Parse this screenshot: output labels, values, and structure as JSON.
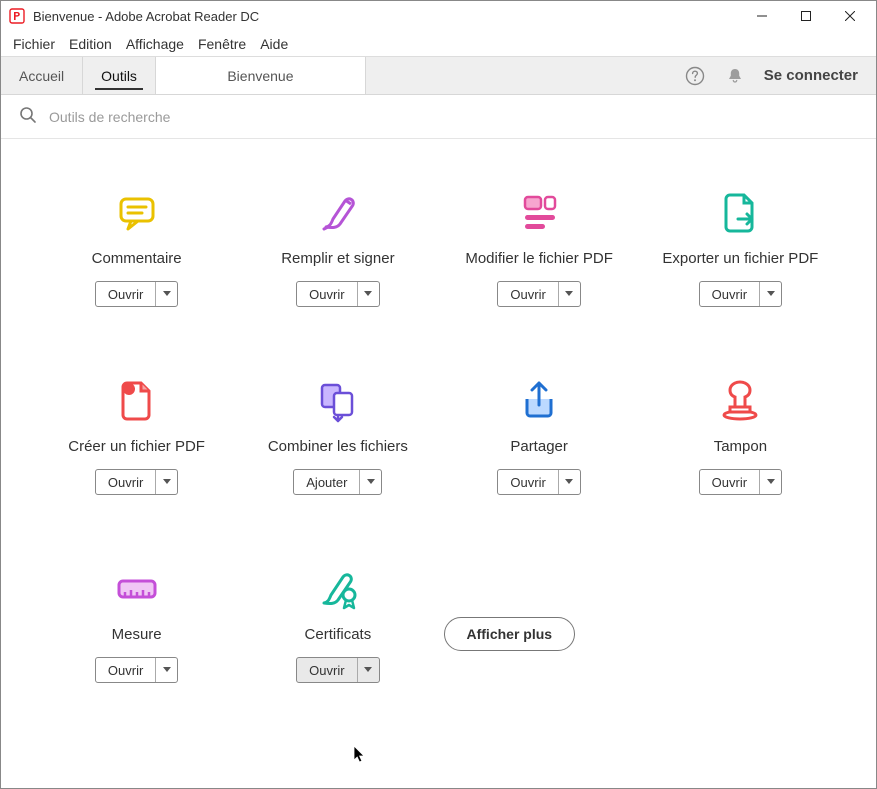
{
  "window": {
    "title": "Bienvenue - Adobe Acrobat Reader DC"
  },
  "menu": {
    "items": [
      "Fichier",
      "Edition",
      "Affichage",
      "Fenêtre",
      "Aide"
    ]
  },
  "tabs": {
    "home": "Accueil",
    "tools": "Outils",
    "document": "Bienvenue",
    "signin": "Se connecter"
  },
  "search": {
    "placeholder": "Outils de recherche"
  },
  "actions": {
    "open": "Ouvrir",
    "add": "Ajouter",
    "more": "Afficher plus"
  },
  "tools": [
    {
      "id": "comment",
      "title": "Commentaire",
      "action": "open"
    },
    {
      "id": "fillsign",
      "title": "Remplir et signer",
      "action": "open"
    },
    {
      "id": "editpdf",
      "title": "Modifier le fichier PDF",
      "action": "open"
    },
    {
      "id": "exportpdf",
      "title": "Exporter un fichier PDF",
      "action": "open"
    },
    {
      "id": "createpdf",
      "title": "Créer un fichier PDF",
      "action": "open"
    },
    {
      "id": "combine",
      "title": "Combiner les fichiers",
      "action": "add"
    },
    {
      "id": "share",
      "title": "Partager",
      "action": "open"
    },
    {
      "id": "stamp",
      "title": "Tampon",
      "action": "open"
    },
    {
      "id": "measure",
      "title": "Mesure",
      "action": "open"
    },
    {
      "id": "cert",
      "title": "Certificats",
      "action": "open",
      "pressed": true
    }
  ]
}
